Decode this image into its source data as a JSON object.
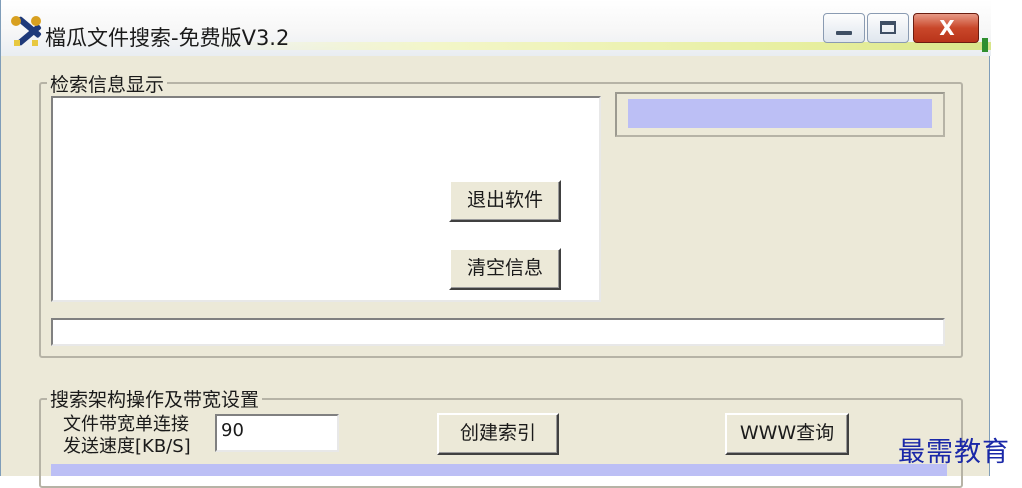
{
  "window": {
    "title": "檔瓜文件搜索-免费版V3.2",
    "close_glyph": "X"
  },
  "search_info_group": {
    "title": "检索信息显示",
    "exit_button": "退出软件",
    "clear_button": "清空信息"
  },
  "settings_group": {
    "title": "搜索架构操作及带宽设置",
    "bandwidth_label_line1": "文件带宽单连接",
    "bandwidth_label_line2": "发送速度[KB/S]",
    "bandwidth_value": "90",
    "create_index_button": "创建索引",
    "www_query_button": "WWW查询"
  },
  "watermark": "最需教育",
  "colors": {
    "lavender_bar": "#bcbff5",
    "dialog_bg": "#ece9d8",
    "close_button": "#c9472a"
  },
  "icons": {
    "app": "tools-icon",
    "minimize": "minimize-icon",
    "maximize": "maximize-icon",
    "close": "close-icon"
  }
}
